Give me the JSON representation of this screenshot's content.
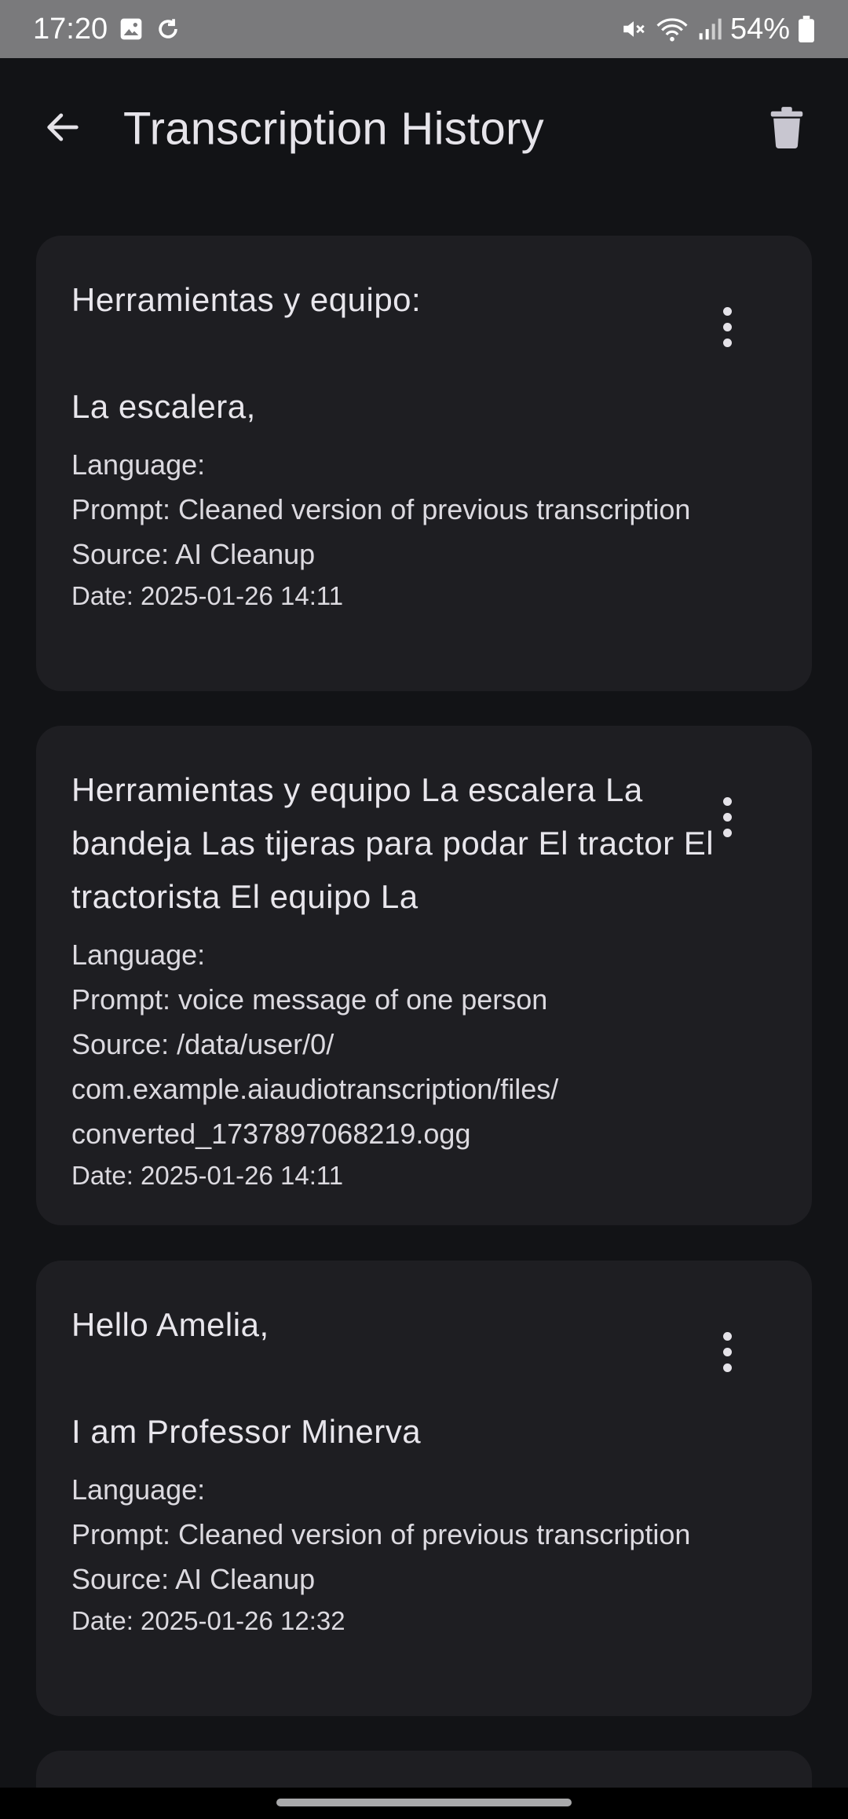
{
  "status_bar": {
    "time": "17:20",
    "battery": "54%",
    "icons": [
      "gallery-icon",
      "sync-icon",
      "mute-icon",
      "wifi-icon",
      "signal-icon",
      "battery-icon"
    ]
  },
  "app_bar": {
    "title": "Transcription History",
    "back_icon": "arrow-back-icon",
    "delete_icon": "trash-icon"
  },
  "history": [
    {
      "text": "Herramientas y equipo:\n\nLa escalera,",
      "language": "Language:",
      "prompt": "Prompt: Cleaned version of previous transcription",
      "source": "Source: AI Cleanup",
      "date": "Date: 2025-01-26 14:11"
    },
    {
      "text": "Herramientas y equipo La escalera La bandeja Las tijeras para podar El tractor El tractorista El equipo La",
      "language": "Language:",
      "prompt": "Prompt: voice message of one person",
      "source": "Source: /data/user/0/\ncom.example.aiaudiotranscription/files/\nconverted_1737897068219.ogg",
      "date": "Date: 2025-01-26 14:11"
    },
    {
      "text": "Hello Amelia,\n\nI am Professor Minerva",
      "language": "Language:",
      "prompt": "Prompt: Cleaned version of previous transcription",
      "source": "Source: AI Cleanup",
      "date": "Date: 2025-01-26 12:32"
    }
  ],
  "colors": {
    "background": "#121316",
    "card": "#1e1e22",
    "status_bar": "#7a7a7c",
    "text": "#e4e2e8"
  }
}
